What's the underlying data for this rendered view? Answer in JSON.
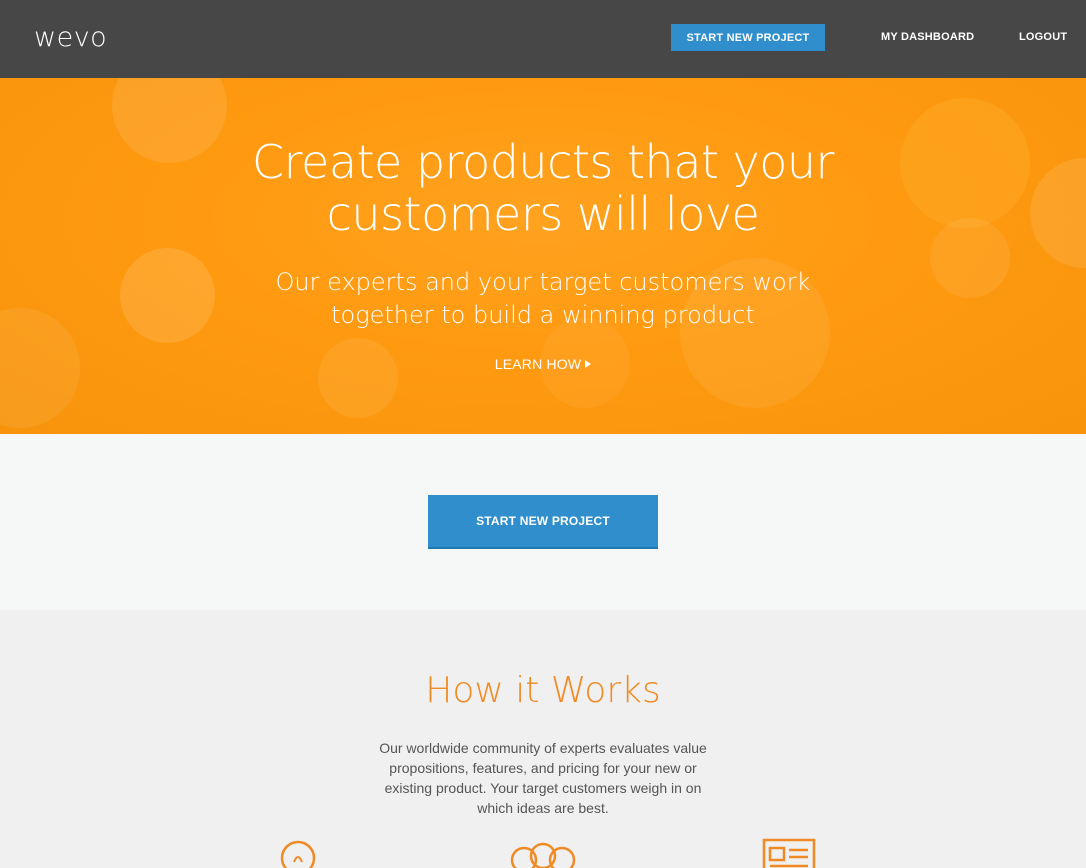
{
  "header": {
    "logo": "wevo",
    "start_project_label": "START NEW PROJECT",
    "dashboard_label": "MY DASHBOARD",
    "logout_label": "LOGOUT"
  },
  "hero": {
    "title_line1": "Create products that your",
    "title_line2": "customers will love",
    "subtitle_line1": "Our experts and your target customers work",
    "subtitle_line2": "together to build a winning product",
    "learn_how_label": "LEARN HOW"
  },
  "cta": {
    "start_project_label": "START NEW PROJECT"
  },
  "how_it_works": {
    "title": "How it Works",
    "text_line1": "Our worldwide community of experts evaluates value",
    "text_line2": "propositions, features, and pricing for your new or",
    "text_line3": "existing product. Your target customers weigh in on",
    "text_line4": "which ideas are best.",
    "icons": [
      "lightbulb-icon",
      "people-icon",
      "newspaper-icon"
    ]
  },
  "colors": {
    "header_bg": "#474747",
    "accent_blue": "#2f8ecb",
    "hero_orange": "#ff9a10",
    "section_orange": "#f08a24"
  }
}
